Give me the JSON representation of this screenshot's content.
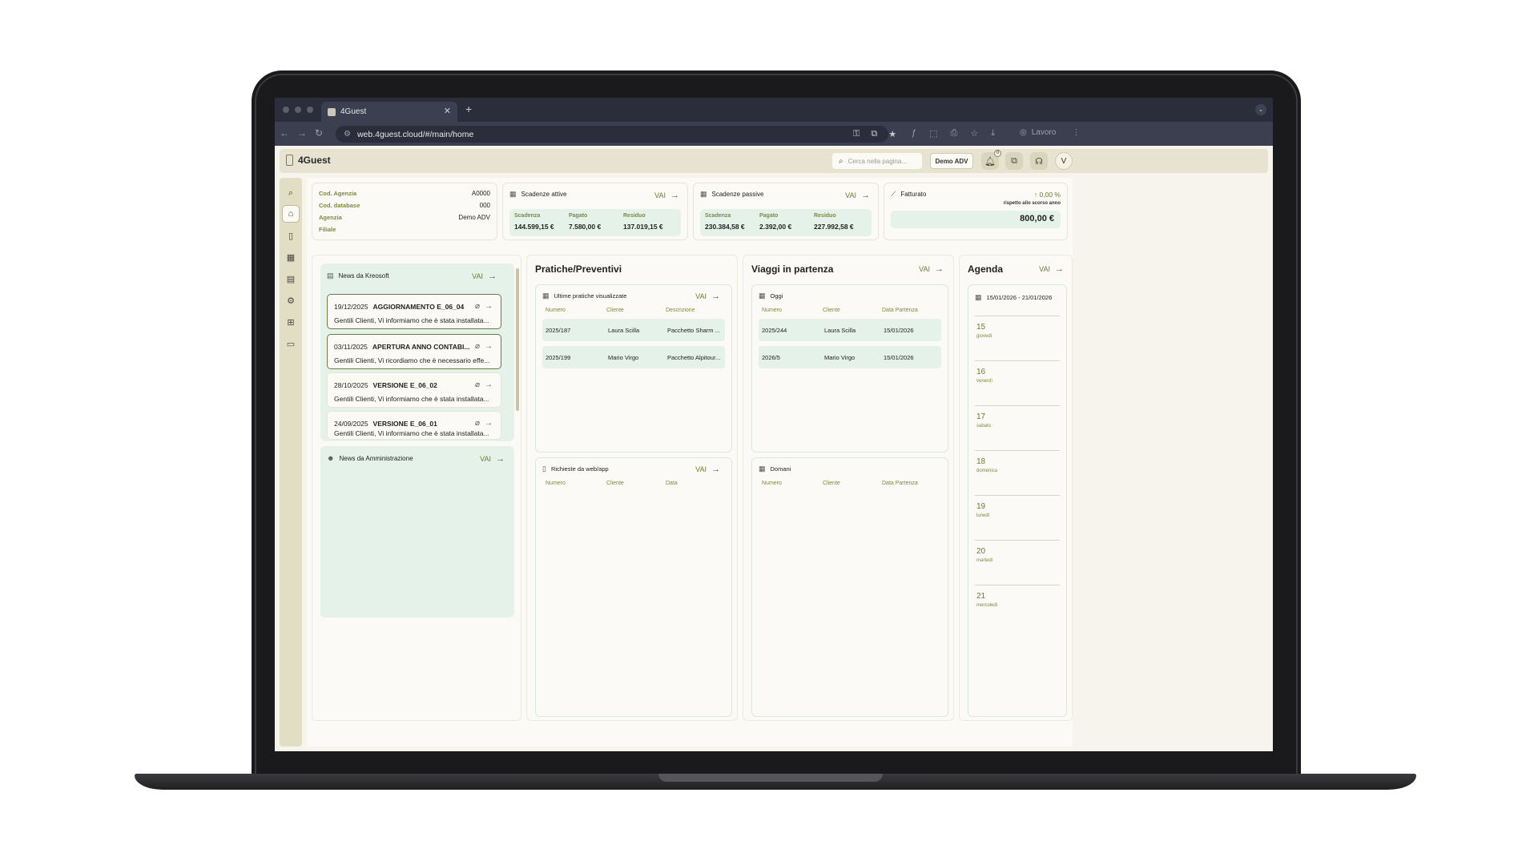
{
  "browser": {
    "tab_title": "4Guest",
    "url": "web.4guest.cloud/#/main/home",
    "profile": "Lavoro"
  },
  "app": {
    "name": "4Guest",
    "search_placeholder": "Cerca nella pagina...",
    "agency_button": "Demo ADV",
    "notification_count": "0",
    "avatar_initial": "V"
  },
  "agency": {
    "rows": [
      {
        "key": "Cod. Agenzia",
        "value": "A0000"
      },
      {
        "key": "Cod. database",
        "value": "000"
      },
      {
        "key": "Agenzia",
        "value": "Demo ADV"
      },
      {
        "key": "Filiale",
        "value": ""
      }
    ]
  },
  "scadenze_attive": {
    "title": "Scadenze attive",
    "vai": "VAI",
    "cols": [
      {
        "label": "Scadenza",
        "value": "144.599,15 €"
      },
      {
        "label": "Pagato",
        "value": "7.580,00 €"
      },
      {
        "label": "Residuo",
        "value": "137.019,15 €"
      }
    ]
  },
  "scadenze_passive": {
    "title": "Scadenze passive",
    "vai": "VAI",
    "cols": [
      {
        "label": "Scadenza",
        "value": "230.384,58 €"
      },
      {
        "label": "Pagato",
        "value": "2.392,00 €"
      },
      {
        "label": "Residuo",
        "value": "227.992,58 €"
      }
    ]
  },
  "fatturato": {
    "title": "Fatturato",
    "pct": "0,00 %",
    "note": "rispetto allo scorso anno",
    "value": "800,00 €"
  },
  "news_kreosoft": {
    "title": "News da Kreosoft",
    "vai": "VAI",
    "items": [
      {
        "date": "19/12/2025",
        "title": "AGGIORNAMENTO E_06_04",
        "body": "Gentili Clienti, Vi informiamo che è stata installata..."
      },
      {
        "date": "03/11/2025",
        "title": "APERTURA ANNO CONTABI...",
        "body": "Gentili Clienti, Vi ricordiamo che è necessario effe..."
      },
      {
        "date": "28/10/2025",
        "title": "VERSIONE E_06_02",
        "body": "Gentili Clienti, Vi informiamo che è stata installata..."
      },
      {
        "date": "24/09/2025",
        "title": "VERSIONE E_06_01",
        "body": "Gentili Clienti, Vi informiamo che è stata installata..."
      }
    ]
  },
  "news_amministrazione": {
    "title": "News da Amministrazione",
    "vai": "VAI"
  },
  "pratiche": {
    "title": "Pratiche/Preventivi",
    "ultime": {
      "title": "Ultime pratiche visualizzate",
      "vai": "VAI",
      "headers": [
        "Numero",
        "Cliente",
        "Descrizione"
      ],
      "rows": [
        [
          "2025/187",
          "Laura Scilla",
          "Pacchetto Sharm ..."
        ],
        [
          "2025/199",
          "Mario Virgo",
          "Pacchetto Alpitour..."
        ]
      ]
    },
    "richieste": {
      "title": "Richieste da web/app",
      "vai": "VAI",
      "headers": [
        "Numero",
        "Cliente",
        "Data"
      ]
    }
  },
  "viaggi": {
    "title": "Viaggi in partenza",
    "vai": "VAI",
    "oggi": {
      "title": "Oggi",
      "headers": [
        "Numero",
        "Cliente",
        "Data Partenza"
      ],
      "rows": [
        [
          "2025/244",
          "Laura Scilla",
          "15/01/2026"
        ],
        [
          "2026/5",
          "Mario Virgo",
          "15/01/2026"
        ]
      ]
    },
    "domani": {
      "title": "Domani",
      "headers": [
        "Numero",
        "Cliente",
        "Data Partenza"
      ]
    }
  },
  "agenda": {
    "title": "Agenda",
    "vai": "VAI",
    "range": "15/01/2026 - 21/01/2026",
    "days": [
      {
        "n": "15",
        "w": "giovedì"
      },
      {
        "n": "16",
        "w": "venerdì"
      },
      {
        "n": "17",
        "w": "sabato"
      },
      {
        "n": "18",
        "w": "domenica"
      },
      {
        "n": "19",
        "w": "lunedì"
      },
      {
        "n": "20",
        "w": "martedì"
      },
      {
        "n": "21",
        "w": "mercoledì"
      }
    ]
  },
  "colors": {
    "accent": "#6c7e2b",
    "panel_green": "#e4f2ea",
    "sidebar": "#e2dec4"
  }
}
